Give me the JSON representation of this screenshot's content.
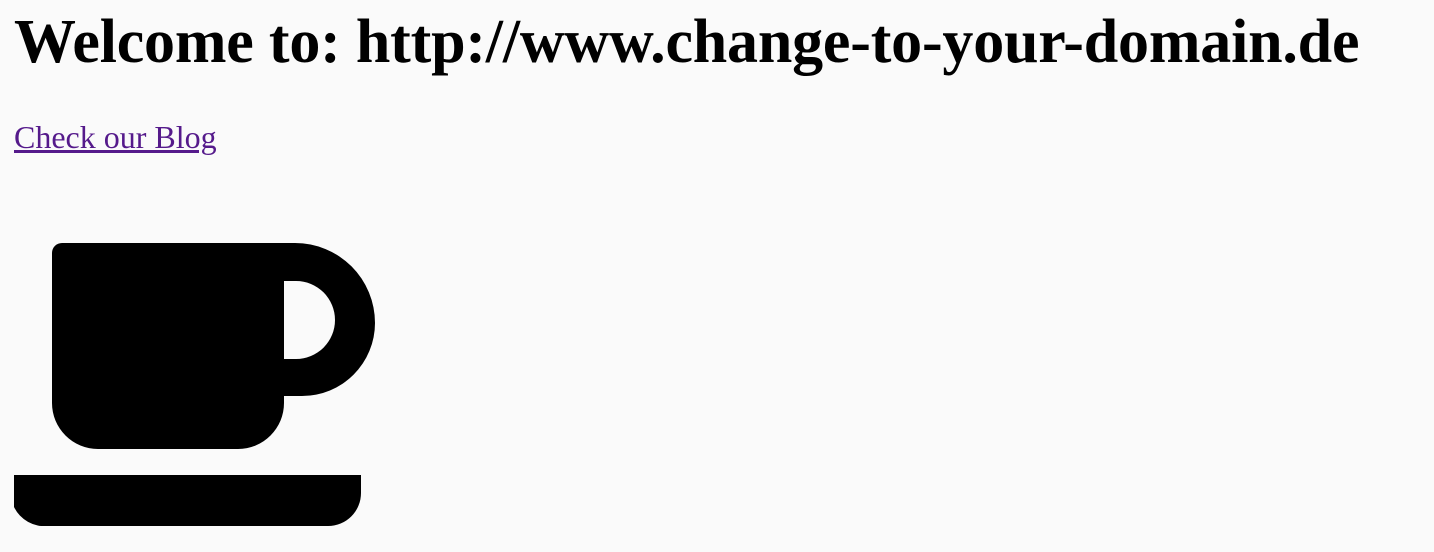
{
  "page": {
    "heading": "Welcome to: http://www.change-to-your-domain.de",
    "blog_link_label": "Check our Blog",
    "icon": "coffee-cup-icon"
  },
  "colors": {
    "background": "#fafafa",
    "text": "#000000",
    "visited_link": "#551a8b"
  }
}
